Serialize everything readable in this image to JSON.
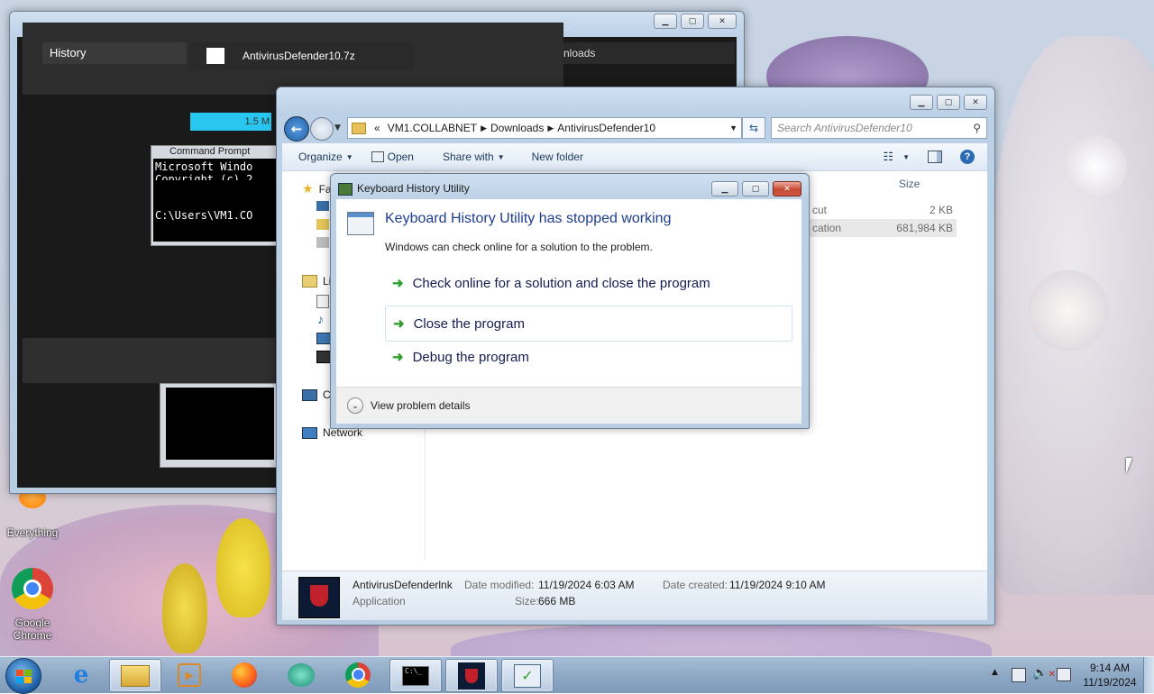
{
  "background_window": {
    "tab_history": "History",
    "file_name": "AntivirusDefender10.7z",
    "tab_downloads_partial": "nloads",
    "size_partial": "1.5 M",
    "cmd_title_partial": "Command Prompt",
    "cmd_line1": "Microsoft Windo",
    "cmd_line2": "Copyright (c) 2",
    "cmd_prompt": "C:\\Users\\VM1.CO"
  },
  "explorer": {
    "address": {
      "prefix": "«",
      "crumbs": [
        "VM1.COLLABNET",
        "Downloads",
        "AntivirusDefender10"
      ]
    },
    "search_placeholder": "Search AntivirusDefender10",
    "toolbar": {
      "organize": "Organize",
      "open": "Open",
      "share_with": "Share with",
      "new_folder": "New folder"
    },
    "nav": {
      "favorites": "Fa",
      "libraries": "Lib",
      "computer": "Co",
      "network": "Network"
    },
    "columns": {
      "size": "Size"
    },
    "rows": [
      {
        "type_partial": "cut",
        "size": "2 KB"
      },
      {
        "type_partial": "cation",
        "size": "681,984 KB"
      }
    ],
    "details": {
      "name": "AntivirusDefenderlnk",
      "type": "Application",
      "modified_label": "Date modified:",
      "modified_value": "11/19/2024 6:03 AM",
      "created_label": "Date created:",
      "created_value": "11/19/2024 9:10 AM",
      "size_label": "Size:",
      "size_value": "666 MB"
    }
  },
  "dialog": {
    "title": "Keyboard History Utility",
    "heading": "Keyboard History Utility has stopped working",
    "subtext": "Windows can check online for a solution to the problem.",
    "actions": [
      "Check online for a solution and close the program",
      "Close the program",
      "Debug the program"
    ],
    "details_toggle": "View problem details"
  },
  "desktop_icons": {
    "everything": "Everything",
    "chrome_line1": "Google",
    "chrome_line2": "Chrome"
  },
  "taskbar": {
    "time": "9:14 AM",
    "date": "11/19/2024",
    "pinned": [
      "internet-explorer",
      "file-explorer",
      "media-player",
      "firefox",
      "vpn",
      "chrome",
      "command-prompt",
      "antivirus-defender",
      "keyboard-history-utility"
    ]
  },
  "colors": {
    "accent_blue": "#1e5fa8",
    "dialog_heading": "#1d3d8f",
    "action_text": "#151c55",
    "arrow_green": "#2f9e2f",
    "taskbar": "#90aac6",
    "close_red": "#c74a33"
  }
}
